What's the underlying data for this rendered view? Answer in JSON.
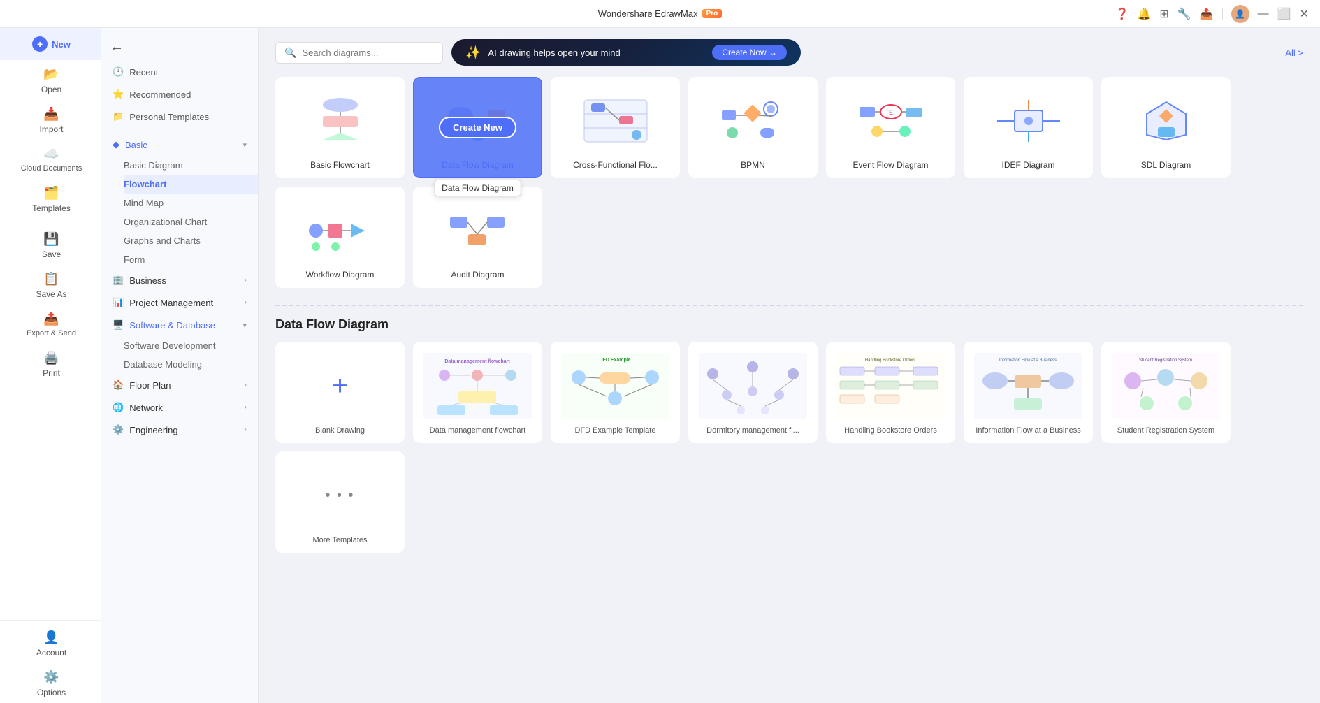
{
  "titlebar": {
    "title": "Wondershare EdrawMax",
    "pro": "Pro"
  },
  "sidebar": {
    "new_label": "New",
    "open_label": "Open",
    "import_label": "Import",
    "cloud_label": "Cloud Documents",
    "templates_label": "Templates",
    "save_label": "Save",
    "saveas_label": "Save As",
    "export_label": "Export & Send",
    "print_label": "Print",
    "account_label": "Account",
    "options_label": "Options"
  },
  "nav": {
    "recent": "Recent",
    "recommended": "Recommended",
    "personal_templates": "Personal Templates",
    "basic": "Basic",
    "basic_diagram": "Basic Diagram",
    "flowchart": "Flowchart",
    "mind_map": "Mind Map",
    "org_chart": "Organizational Chart",
    "graphs_charts": "Graphs and Charts",
    "form": "Form",
    "business": "Business",
    "project_management": "Project Management",
    "software_database": "Software & Database",
    "software_dev": "Software Development",
    "database_modeling": "Database Modeling",
    "floor_plan": "Floor Plan",
    "network": "Network",
    "engineering": "Engineering"
  },
  "topbar": {
    "search_placeholder": "Search diagrams...",
    "ai_text": "AI drawing helps open your mind",
    "ai_btn": "Create Now →",
    "all_link": "All >"
  },
  "diagram_types": [
    {
      "id": "basic-flowchart",
      "label": "Basic Flowchart",
      "selected": false
    },
    {
      "id": "data-flow-diagram",
      "label": "Data Flow Diagram",
      "selected": true
    },
    {
      "id": "cross-functional",
      "label": "Cross-Functional Flo...",
      "selected": false
    },
    {
      "id": "bpmn",
      "label": "BPMN",
      "selected": false
    },
    {
      "id": "event-flow",
      "label": "Event Flow Diagram",
      "selected": false
    },
    {
      "id": "idef",
      "label": "IDEF Diagram",
      "selected": false
    },
    {
      "id": "sdl",
      "label": "SDL Diagram",
      "selected": false
    },
    {
      "id": "workflow",
      "label": "Workflow Diagram",
      "selected": false
    },
    {
      "id": "audit",
      "label": "Audit Diagram",
      "selected": false
    }
  ],
  "create_new_label": "Create New",
  "tooltip_label": "Data Flow Diagram",
  "section_title": "Data Flow Diagram",
  "templates": [
    {
      "id": "blank",
      "label": "Blank Drawing",
      "type": "blank"
    },
    {
      "id": "data-mgmt",
      "label": "Data management flowchart",
      "type": "template"
    },
    {
      "id": "dfd-example",
      "label": "DFD Example Template",
      "type": "template"
    },
    {
      "id": "dormitory",
      "label": "Dormitory management fl...",
      "type": "template"
    },
    {
      "id": "bookstore",
      "label": "Handling Bookstore Orders",
      "type": "template"
    },
    {
      "id": "info-flow",
      "label": "Information Flow at a Business",
      "type": "template"
    },
    {
      "id": "student-reg",
      "label": "Student Registration System",
      "type": "template"
    },
    {
      "id": "more",
      "label": "More Templates",
      "type": "more"
    }
  ]
}
